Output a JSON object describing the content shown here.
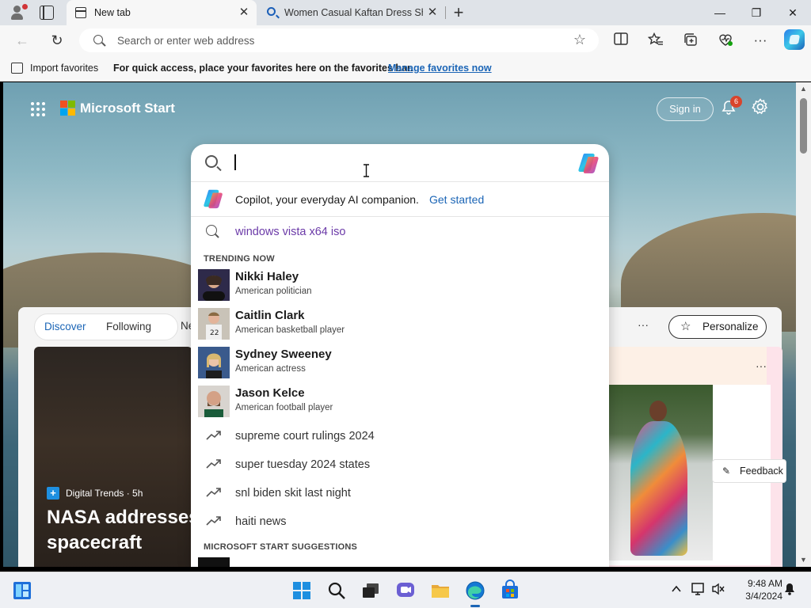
{
  "browser": {
    "tabs": [
      {
        "label": "New tab",
        "close": "✕"
      },
      {
        "label": "Women Casual Kaftan Dress Sho",
        "close": "✕"
      }
    ],
    "new_tab_symbol": "+",
    "window_controls": {
      "minimize": "—",
      "restore": "❐",
      "close": "✕"
    },
    "address_placeholder": "Search or enter web address",
    "back_symbol": "←",
    "refresh_symbol": "↻",
    "favorite_star": "☆",
    "toolbar_icons": [
      "split-screen-icon",
      "favorites-icon",
      "collections-icon",
      "browser-essentials-icon",
      "more-icon",
      "copilot-icon"
    ],
    "more_symbol": "···"
  },
  "favorites_bar": {
    "import_label": "Import favorites",
    "message": "For quick access, place your favorites here on the favorites bar.",
    "link": "Manage favorites now"
  },
  "start_page": {
    "brand": "Microsoft Start",
    "sign_in": "Sign in",
    "notification_count": "6",
    "feed_tabs": [
      "Discover",
      "Following",
      "Ne"
    ],
    "more": "···",
    "personalize": "Personalize",
    "card": {
      "source": "Digital Trends · 5h",
      "headline_line1": "NASA addresses",
      "headline_line2": "spacecraft"
    },
    "card_right_more": "···",
    "feedback": "Feedback",
    "accent_color": "#1b65b6"
  },
  "search_dropdown": {
    "input_value": "",
    "copilot_text": "Copilot, your everyday AI companion.",
    "copilot_link": "Get started",
    "history": "windows vista x64 iso",
    "trending_header": "TRENDING NOW",
    "entities": [
      {
        "name": "Nikki Haley",
        "desc": "American politician"
      },
      {
        "name": "Caitlin Clark",
        "desc": "American basketball player"
      },
      {
        "name": "Sydney Sweeney",
        "desc": "American actress"
      },
      {
        "name": "Jason Kelce",
        "desc": "American football player"
      }
    ],
    "trending_queries": [
      "supreme court rulings 2024",
      "super tuesday 2024 states",
      "snl biden skit last night",
      "haiti news"
    ],
    "suggestions_header": "MICROSOFT START SUGGESTIONS"
  },
  "taskbar": {
    "apps": [
      "widgets-icon",
      "start-icon",
      "search-icon",
      "task-view-icon",
      "chat-icon",
      "file-explorer-icon",
      "edge-icon",
      "store-icon"
    ],
    "tray_chevron": "^",
    "time": "9:48 AM",
    "date": "3/4/2024"
  }
}
